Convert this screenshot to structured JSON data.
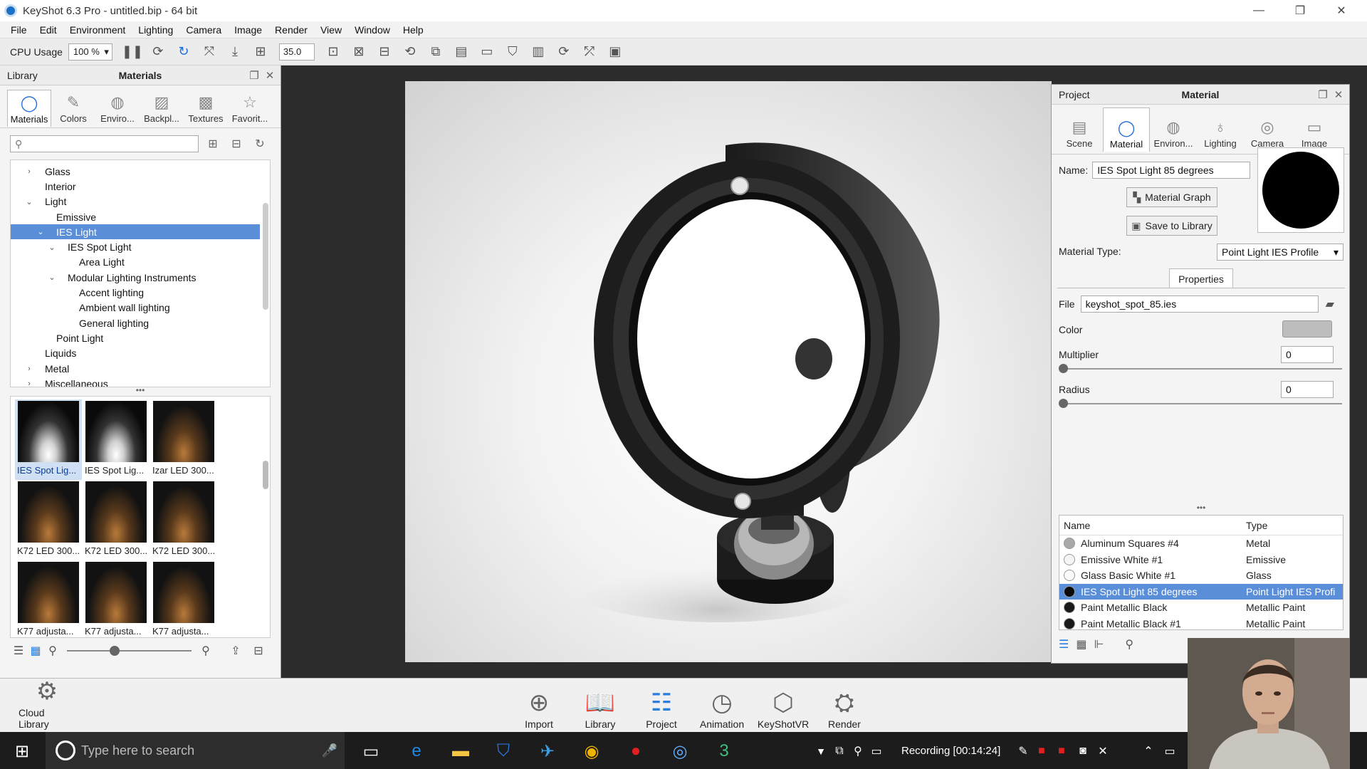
{
  "window": {
    "title": "KeyShot 6.3 Pro - untitled.bip - 64 bit"
  },
  "menu": [
    "File",
    "Edit",
    "Environment",
    "Lighting",
    "Camera",
    "Image",
    "Render",
    "View",
    "Window",
    "Help"
  ],
  "toolbar": {
    "cpu_label": "CPU Usage",
    "cpu_value": "100 %",
    "fov_value": "35.0"
  },
  "library": {
    "header_left": "Library",
    "header_title": "Materials",
    "tabs": [
      "Materials",
      "Colors",
      "Enviro...",
      "Backpl...",
      "Textures",
      "Favorit..."
    ],
    "search_placeholder": "",
    "tree": [
      {
        "label": "Glass",
        "indent": 0,
        "arrow": "›",
        "selected": false
      },
      {
        "label": "Interior",
        "indent": 0,
        "arrow": "",
        "selected": false
      },
      {
        "label": "Light",
        "indent": 0,
        "arrow": "⌄",
        "selected": false
      },
      {
        "label": "Emissive",
        "indent": 1,
        "arrow": "",
        "selected": false
      },
      {
        "label": "IES Light",
        "indent": 1,
        "arrow": "⌄",
        "selected": true
      },
      {
        "label": "IES Spot Light",
        "indent": 2,
        "arrow": "⌄",
        "selected": false
      },
      {
        "label": "Area Light",
        "indent": 3,
        "arrow": "",
        "selected": false
      },
      {
        "label": "Modular Lighting Instruments",
        "indent": 2,
        "arrow": "⌄",
        "selected": false
      },
      {
        "label": "Accent lighting",
        "indent": 3,
        "arrow": "",
        "selected": false
      },
      {
        "label": "Ambient wall lighting",
        "indent": 3,
        "arrow": "",
        "selected": false
      },
      {
        "label": "General lighting",
        "indent": 3,
        "arrow": "",
        "selected": false
      },
      {
        "label": "Point Light",
        "indent": 1,
        "arrow": "",
        "selected": false
      },
      {
        "label": "Liquids",
        "indent": 0,
        "arrow": "",
        "selected": false
      },
      {
        "label": "Metal",
        "indent": 0,
        "arrow": "›",
        "selected": false
      },
      {
        "label": "Miscellaneous",
        "indent": 0,
        "arrow": "›",
        "selected": false
      }
    ],
    "thumbnails": [
      {
        "caption": "IES Spot Lig...",
        "kind": "spot",
        "selected": true
      },
      {
        "caption": "IES Spot Lig...",
        "kind": "spot",
        "selected": false
      },
      {
        "caption": "Izar LED 300...",
        "kind": "warm",
        "selected": false
      },
      {
        "caption": "K72 LED 300...",
        "kind": "warm",
        "selected": false
      },
      {
        "caption": "K72 LED 300...",
        "kind": "warm",
        "selected": false
      },
      {
        "caption": "K72 LED 300...",
        "kind": "warm",
        "selected": false
      },
      {
        "caption": "K77 adjusta...",
        "kind": "warm",
        "selected": false
      },
      {
        "caption": "K77 adjusta...",
        "kind": "warm",
        "selected": false
      },
      {
        "caption": "K77 adjusta...",
        "kind": "warm",
        "selected": false
      }
    ]
  },
  "project": {
    "header_left": "Project",
    "header_title": "Material",
    "tabs": [
      "Scene",
      "Material",
      "Environ...",
      "Lighting",
      "Camera",
      "Image"
    ],
    "name_label": "Name:",
    "name_value": "IES Spot Light 85 degrees",
    "material_graph_label": "Material Graph",
    "save_library_label": "Save to Library",
    "material_type_label": "Material Type:",
    "material_type_value": "Point Light IES Profile",
    "properties_tab": "Properties",
    "file_label": "File",
    "file_value": "keyshot_spot_85.ies",
    "color_label": "Color",
    "color_swatch": "#bdbdbd",
    "multiplier_label": "Multiplier",
    "multiplier_value": "0",
    "radius_label": "Radius",
    "radius_value": "0",
    "table_headers": {
      "name": "Name",
      "type": "Type"
    },
    "materials": [
      {
        "name": "Aluminum Squares #4",
        "type": "Metal",
        "swatch": "#a9a9a9",
        "selected": false
      },
      {
        "name": "Emissive White #1",
        "type": "Emissive",
        "swatch": "#f5f5f5",
        "selected": false
      },
      {
        "name": "Glass Basic White #1",
        "type": "Glass",
        "swatch": "#fafafa",
        "selected": false
      },
      {
        "name": "IES Spot Light 85 degrees",
        "type": "Point Light IES Profi",
        "swatch": "#0a0a0a",
        "selected": true
      },
      {
        "name": "Paint Metallic Black",
        "type": "Metallic Paint",
        "swatch": "#1a1a1a",
        "selected": false
      },
      {
        "name": "Paint Metallic Black #1",
        "type": "Metallic Paint",
        "swatch": "#1a1a1a",
        "selected": false
      }
    ]
  },
  "ribbon": {
    "cloud_library": "Cloud Library",
    "buttons": [
      "Import",
      "Library",
      "Project",
      "Animation",
      "KeyShotVR",
      "Render"
    ]
  },
  "taskbar": {
    "search_placeholder": "Type here to search",
    "recording_text": "Recording [00:14:24]"
  }
}
